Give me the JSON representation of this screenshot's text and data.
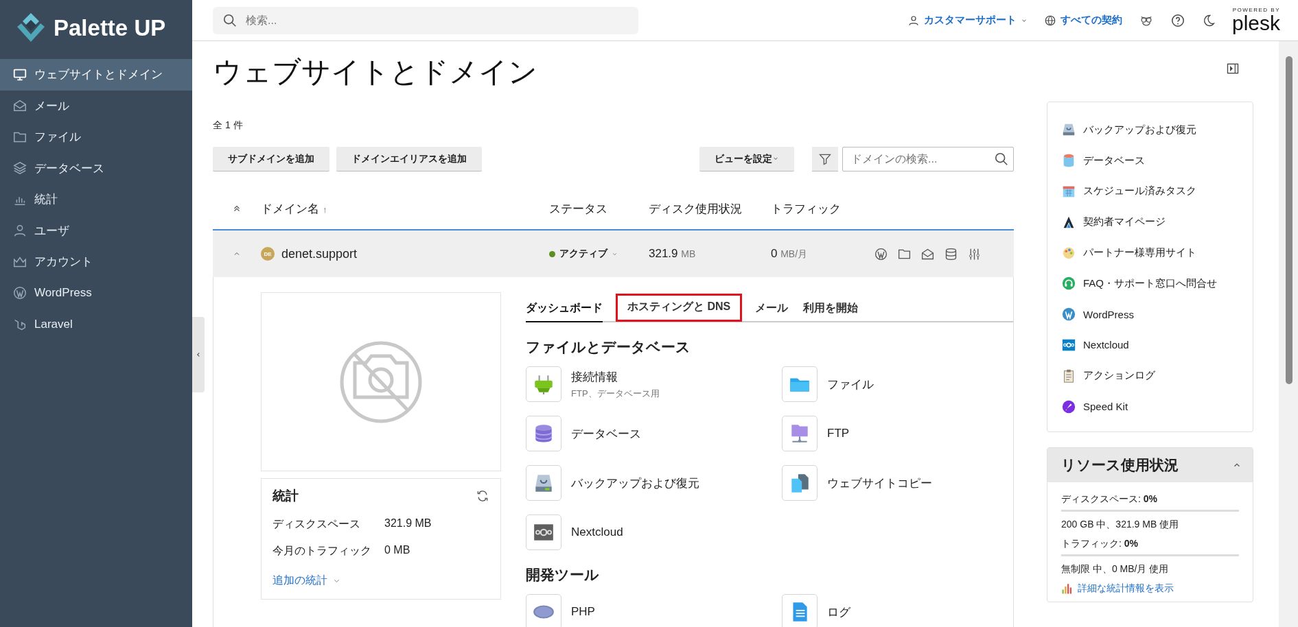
{
  "brand": {
    "name": "Palette UP"
  },
  "sidebar": {
    "items": [
      {
        "label": "ウェブサイトとドメイン",
        "selected": true
      },
      {
        "label": "メール",
        "selected": false
      },
      {
        "label": "ファイル",
        "selected": false
      },
      {
        "label": "データベース",
        "selected": false
      },
      {
        "label": "統計",
        "selected": false
      },
      {
        "label": "ユーザ",
        "selected": false
      },
      {
        "label": "アカウント",
        "selected": false
      },
      {
        "label": "WordPress",
        "selected": false
      },
      {
        "label": "Laravel",
        "selected": false
      }
    ]
  },
  "search": {
    "placeholder": "検索..."
  },
  "header_links": [
    {
      "label": "カスタマーサポート",
      "has_menu": true
    },
    {
      "label": "すべての契約",
      "has_menu": false
    }
  ],
  "powered_by": {
    "caption": "POWERED BY",
    "brand": "plesk"
  },
  "page": {
    "title": "ウェブサイトとドメイン",
    "count": "全 1 件"
  },
  "toolbar": {
    "buttons": [
      "サブドメインを追加",
      "ドメインエイリアスを追加"
    ],
    "view_button": "ビューを設定",
    "search_placeholder": "ドメインの検索..."
  },
  "table": {
    "columns": [
      {
        "label": "ドメイン名",
        "sort": "↑"
      },
      {
        "label": "ステータス"
      },
      {
        "label": "ディスク使用状況"
      },
      {
        "label": "トラフィック"
      }
    ],
    "rows": [
      {
        "favicon": "DE",
        "domain": "denet.support",
        "expanded": true,
        "status": "アクティブ",
        "color": "#5b8f22",
        "disk": "321.9",
        "disk_unit": "MB",
        "traffic": "0",
        "traffic_unit": "MB/月"
      }
    ]
  },
  "detail": {
    "tabs": [
      {
        "label": "ダッシュボード",
        "selected": true,
        "annotated": false
      },
      {
        "label": "ホスティングと DNS",
        "selected": false,
        "annotated": true
      },
      {
        "label": "メール",
        "selected": false,
        "annotated": false
      },
      {
        "label": "利用を開始",
        "selected": false,
        "annotated": false
      }
    ],
    "sections": [
      {
        "title": "ファイルとデータベース",
        "items": [
          {
            "label": "接続情報",
            "sub": "FTP、データベース用"
          },
          {
            "label": "ファイル"
          },
          {
            "label": "データベース"
          },
          {
            "label": "FTP"
          },
          {
            "label": "バックアップおよび復元"
          },
          {
            "label": "ウェブサイトコピー"
          },
          {
            "label": "Nextcloud"
          }
        ]
      },
      {
        "title": "開発ツール",
        "items": [
          {
            "label": "PHP"
          },
          {
            "label": "ログ"
          }
        ]
      }
    ],
    "stats": {
      "title": "統計",
      "rows": [
        {
          "label": "ディスクスペース",
          "value": "321.9 MB"
        },
        {
          "label": "今月のトラフィック",
          "value": "0 MB"
        }
      ],
      "more": "追加の統計"
    }
  },
  "right_panel": {
    "links": [
      "バックアップおよび復元",
      "データベース",
      "スケジュール済みタスク",
      "契約者マイページ",
      "パートナー様専用サイト",
      "FAQ・サポート窓口へ問合せ",
      "WordPress",
      "Nextcloud",
      "アクションログ",
      "Speed Kit"
    ],
    "resources": {
      "title": "リソース使用状況",
      "expanded": true,
      "meters": [
        {
          "label": "ディスクスペース: **0%**",
          "level": 0,
          "detail": "200 GB 中、321.9 MB 使用"
        },
        {
          "label": "トラフィック: **0%**",
          "level": 0,
          "detail": "無制限 中、0 MB/月 使用"
        }
      ],
      "link": "詳細な統計情報を表示"
    }
  }
}
